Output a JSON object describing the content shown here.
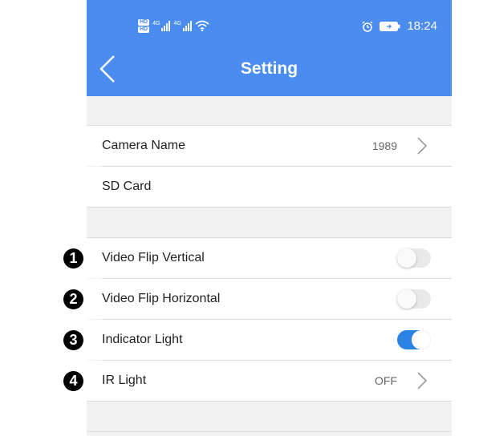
{
  "status_bar": {
    "hd_badges": [
      "HD",
      "HD"
    ],
    "signal_tags": [
      "4G",
      "4G"
    ],
    "time": "18:24",
    "icons": [
      "signal-icon",
      "wifi-icon",
      "alarm-icon",
      "battery-icon"
    ]
  },
  "header": {
    "title": "Setting",
    "back_icon": "chevron-left-icon"
  },
  "section1": [
    {
      "label": "Camera Name",
      "value": "1989",
      "chevron": true
    },
    {
      "label": "SD Card"
    }
  ],
  "section2": [
    {
      "marker": "1",
      "label": "Video Flip Vertical",
      "toggle": false
    },
    {
      "marker": "2",
      "label": "Video Flip Horizontal",
      "toggle": false
    },
    {
      "marker": "3",
      "label": "Indicator Light",
      "toggle": true
    },
    {
      "marker": "4",
      "label": "IR Light",
      "value": "OFF",
      "chevron": true
    }
  ],
  "colors": {
    "header_bg": "#4a8cf0",
    "toggle_on": "#2a82e4",
    "page_bg": "#f2f2f2"
  }
}
